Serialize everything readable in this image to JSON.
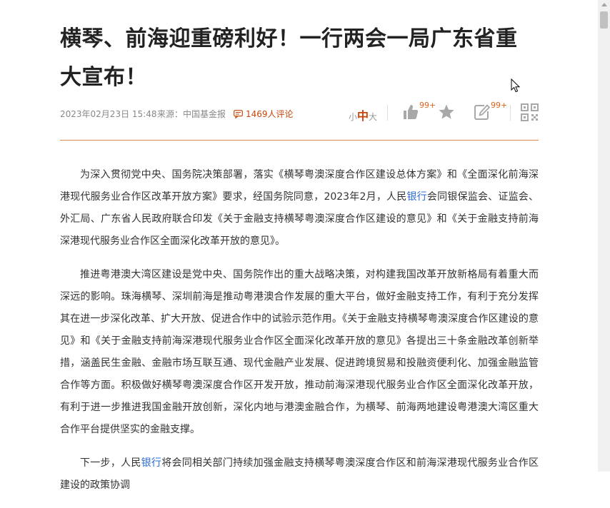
{
  "article": {
    "title": "横琴、前海迎重磅利好！一行两会一局广东省重大宣布！",
    "date": "2023年02月23日 15:48",
    "source": "来源：中国基金报",
    "comments_count": "1469",
    "comments_suffix": "人评论",
    "paragraphs": [
      [
        {
          "t": "为深入贯彻党中央、国务院决策部署，落实《横琴粤澳深度合作区建设总体方案》和《全面深化前海深港现代服务业合作区改革开放方案》要求，经国务院同意，2023年2月，人民"
        },
        {
          "t": "银行",
          "link": true
        },
        {
          "t": "会同银保监会、证监会、外汇局、广东省人民政府联合印发《关于金融支持横琴粤澳深度合作区建设的意见》和《关于金融支持前海深港现代服务业合作区全面深化改革开放的意见》。"
        }
      ],
      [
        {
          "t": "推进粤港澳大湾区建设是党中央、国务院作出的重大战略决策，对构建我国改革开放新格局有着重大而深远的影响。珠海横琴、深圳前海是推动粤港澳合作发展的重大平台，做好金融支持工作，有利于充分发挥其在进一步深化改革、扩大开放、促进合作中的试验示范作用。《关于金融支持横琴粤澳深度合作区建设的意见》和《关于金融支持前海深港现代服务业合作区全面深化改革开放的意见》各提出三十条金融改革创新举措，涵盖民生金融、金融市场互联互通、现代金融产业发展、促进跨境贸易和投融资便利化、加强金融监管合作等方面。积极做好横琴粤澳深度合作区开发开放，推动前海深港现代服务业合作区全面深化改革开放，有利于进一步推进我国金融开放创新，深化内地与港澳金融合作，为横琴、前海两地建设粤港澳大湾区重大合作平台提供坚实的金融支撑。"
        }
      ],
      [
        {
          "t": "下一步，人民"
        },
        {
          "t": "银行",
          "link": true
        },
        {
          "t": "将会同相关部门持续加强金融支持横琴粤澳深度合作区和前海深港现代服务业合作区建设的政策协调"
        }
      ]
    ]
  },
  "toolbar": {
    "font_small": "小",
    "font_mid": "中",
    "font_large": "大",
    "like_badge": "99+",
    "comment_badge": "99+",
    "icons": [
      "thumb-up-icon",
      "star-icon",
      "edit-icon",
      "qr-code-icon"
    ]
  },
  "colors": {
    "accent": "#c8450a",
    "badge": "#e0631b",
    "link": "#2c6bd2",
    "divider": "#d9884e",
    "icon_gray": "#a8a8a8"
  }
}
